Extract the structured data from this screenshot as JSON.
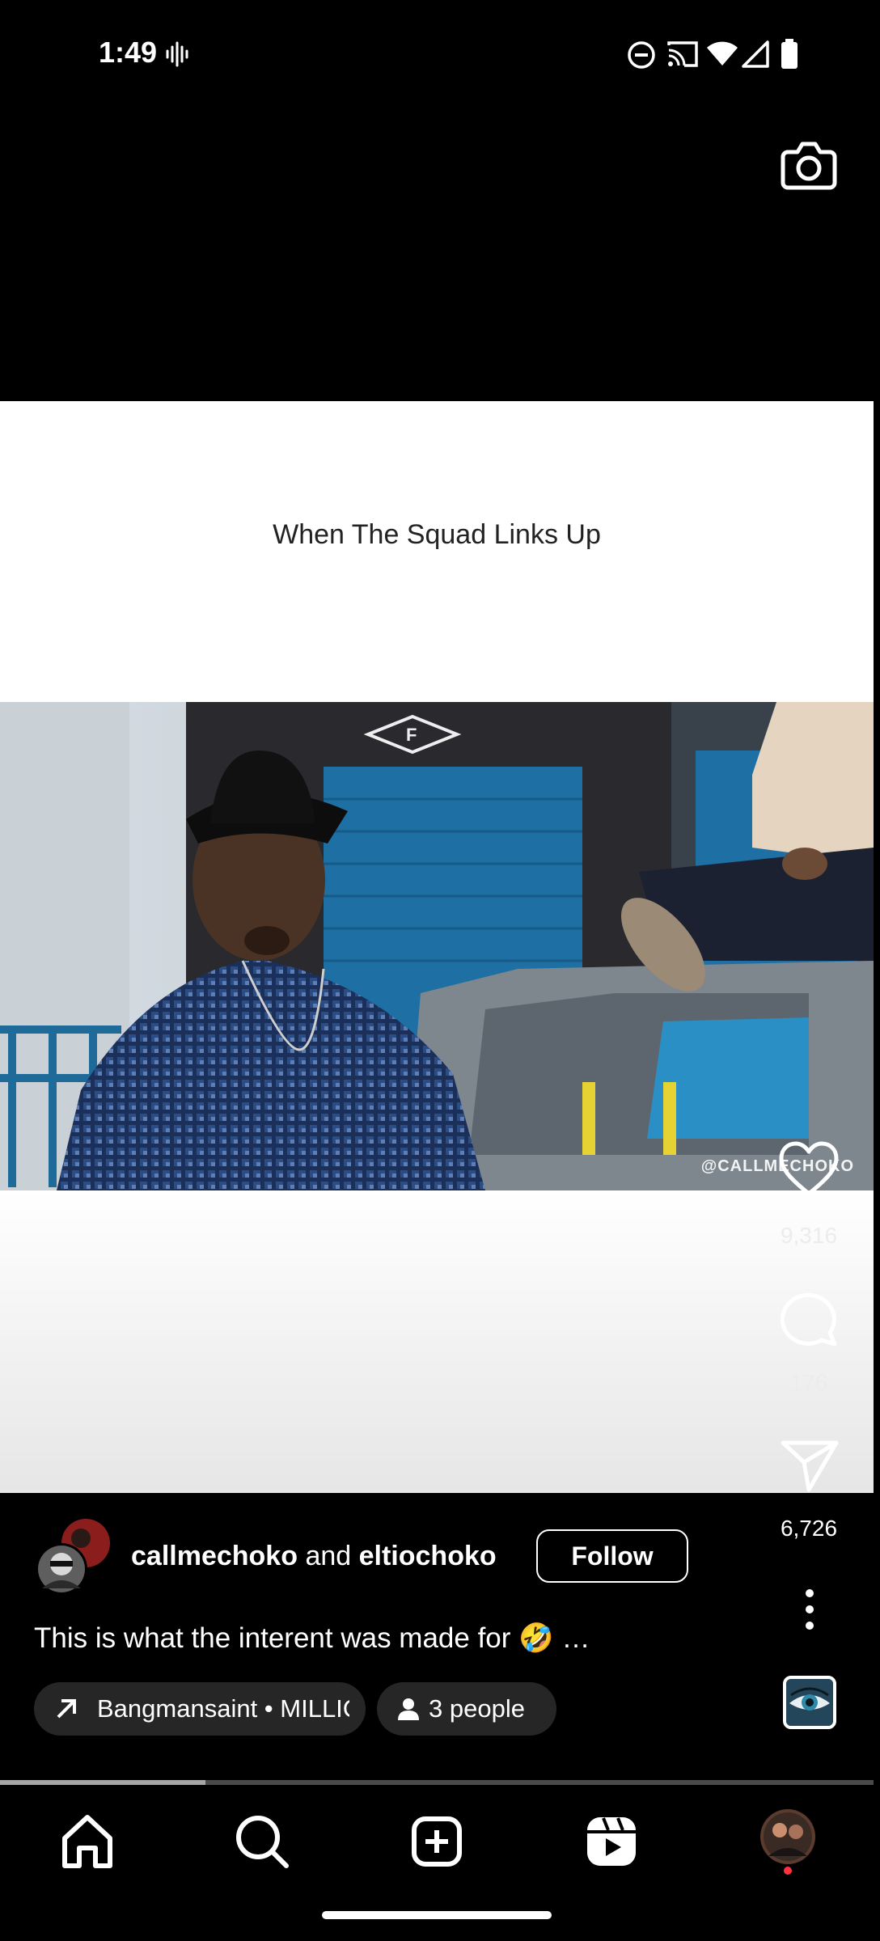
{
  "status_bar": {
    "time": "1:49",
    "icons": [
      "voicemail-icon",
      "do-not-disturb-icon",
      "cast-icon",
      "wifi-icon",
      "signal-icon",
      "battery-icon"
    ]
  },
  "video": {
    "caption_text": "When The Squad Links Up",
    "watermark": "@CALLMECHOKO"
  },
  "actions": {
    "likes": "9,316",
    "comments": "176",
    "shares": "6,726"
  },
  "post": {
    "author_primary": "callmechoko",
    "author_joiner": "and",
    "author_secondary": "eltiochoko",
    "follow_label": "Follow",
    "caption": "This is what the interent was made for 🤣 …",
    "audio_label": "Bangmansaint • MILLIC",
    "people_label": "3 people",
    "progress": 0.235
  },
  "nav": {
    "items": [
      "home-icon",
      "search-icon",
      "create-icon",
      "reels-icon",
      "profile-avatar"
    ]
  },
  "colors": {
    "background": "#000000",
    "chip": "#262626",
    "notification_dot": "#ff3040"
  }
}
